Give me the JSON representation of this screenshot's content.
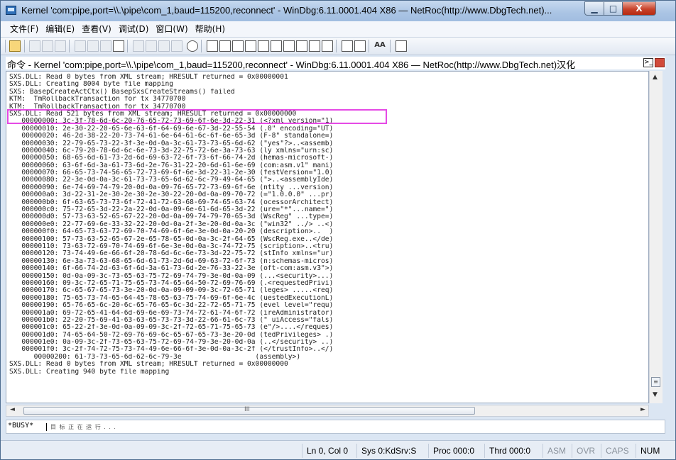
{
  "window": {
    "title": "Kernel 'com:pipe,port=\\\\.\\pipe\\com_1,baud=115200,reconnect' - WinDbg:6.11.0001.404 X86 — NetRoc(http://www.DbgTech.net)...",
    "min_glyph": "▁",
    "max_glyph": "□",
    "close_glyph": "X"
  },
  "menu": [
    "文件(F)",
    "编辑(E)",
    "查看(V)",
    "调试(D)",
    "窗口(W)",
    "帮助(H)"
  ],
  "toolbar": {
    "font_label": "AA"
  },
  "command_window": {
    "title": "命令 - Kernel 'com:pipe,port=\\\\.\\pipe\\com_1,baud=115200,reconnect' - WinDbg:6.11.0001.404 X86 — NetRoc(http://www.DbgTech.net)汉化"
  },
  "output": [
    "SXS.DLL: Read 0 bytes from XML stream; HRESULT returned = 0x00000001",
    "SXS.DLL: Creating 8004 byte file mapping",
    "SXS: BasepCreateActCtx() BasepSxsCreateStreams() failed",
    "KTM:  TmRollbackTransaction for tx 34770700",
    "KTM:  TmRollbackTransaction for tx 34770700",
    "SXS.DLL: Read 521 bytes from XML stream; HRESULT returned = 0x00000000",
    "   00000000: 3c-3f-78-6d-6c-20-76-65-72-73-69-6f-6e-3d-22-31 (<?xml version=\"1)",
    "   00000010: 2e-30-22-20-65-6e-63-6f-64-69-6e-67-3d-22-55-54 (.0\" encoding=\"UT)",
    "   00000020: 46-2d-38-22-20-73-74-61-6e-64-61-6c-6f-6e-65-3d (F-8\" standalone=)",
    "   00000030: 22-79-65-73-22-3f-3e-0d-0a-3c-61-73-73-65-6d-62 (\"yes\"?>..<assemb)",
    "   00000040: 6c-79-20-78-6d-6c-6e-73-3d-22-75-72-6e-3a-73-63 (ly xmlns=\"urn:sc)",
    "   00000050: 68-65-6d-61-73-2d-6d-69-63-72-6f-73-6f-66-74-2d (hemas-microsoft-)",
    "   00000060: 63-6f-6d-3a-61-73-6d-2e-76-31-22-20-6d-61-6e-69 (com:asm.v1\" mani)",
    "   00000070: 66-65-73-74-56-65-72-73-69-6f-6e-3d-22-31-2e-30 (festVersion=\"1.0)",
    "   00000080: 22-3e-0d-0a-3c-61-73-73-65-6d-62-6c-79-49-64-65 (\">..<assemblyIde)",
    "   00000090: 6e-74-69-74-79-20-0d-0a-09-76-65-72-73-69-6f-6e (ntity ...version)",
    "   000000a0: 3d-22-31-2e-30-2e-30-2e-30-22-20-0d-0a-09-70-72 (=\"1.0.0.0\" ...pr)",
    "   000000b0: 6f-63-65-73-73-6f-72-41-72-63-68-69-74-65-63-74 (ocessorArchitect)",
    "   000000c0: 75-72-65-3d-22-2a-22-0d-0a-09-6e-61-6d-65-3d-22 (ure=\"*\"...name=\")",
    "   000000d0: 57-73-63-52-65-67-22-20-0d-0a-09-74-79-70-65-3d (WscReg\" ...type=)",
    "   000000e0: 22-77-69-6e-33-32-22-20-0d-0a-2f-3e-20-0d-0a-3c (\"win32\" ../> ..<)",
    "   000000f0: 64-65-73-63-72-69-70-74-69-6f-6e-3e-0d-0a-20-20 (description>..  )",
    "   00000100: 57-73-63-52-65-67-2e-65-78-65-0d-0a-3c-2f-64-65 (WscReg.exe..</de)",
    "   00000110: 73-63-72-69-70-74-69-6f-6e-3e-0d-0a-3c-74-72-75 (scription>..<tru)",
    "   00000120: 73-74-49-6e-66-6f-20-78-6d-6c-6e-73-3d-22-75-72 (stInfo xmlns=\"ur)",
    "   00000130: 6e-3a-73-63-68-65-6d-61-73-2d-6d-69-63-72-6f-73 (n:schemas-micros)",
    "   00000140: 6f-66-74-2d-63-6f-6d-3a-61-73-6d-2e-76-33-22-3e (oft-com:asm.v3\">)",
    "   00000150: 0d-0a-09-3c-73-65-63-75-72-69-74-79-3e-0d-0a-09 (...<security>...)",
    "   00000160: 09-3c-72-65-71-75-65-73-74-65-64-50-72-69-76-69 (.<requestedPrivi)",
    "   00000170: 6c-65-67-65-73-3e-20-0d-0a-09-09-09-3c-72-65-71 (leges> .....<req)",
    "   00000180: 75-65-73-74-65-64-45-78-65-63-75-74-69-6f-6e-4c (uestedExecutionL)",
    "   00000190: 65-76-65-6c-20-6c-65-76-65-6c-3d-22-72-65-71-75 (evel level=\"requ)",
    "   000001a0: 69-72-65-41-64-6d-69-6e-69-73-74-72-61-74-6f-72 (ireAdministrator)",
    "   000001b0: 22-20-75-69-41-63-63-65-73-73-3d-22-66-61-6c-73 (\" uiAccess=\"fals)",
    "   000001c0: 65-22-2f-3e-0d-0a-09-09-3c-2f-72-65-71-75-65-73 (e\"/>....</reques)",
    "   000001d0: 74-65-64-50-72-69-76-69-6c-65-67-65-73-3e-20-0d (tedPrivileges> .)",
    "   000001e0: 0a-09-3c-2f-73-65-63-75-72-69-74-79-3e-20-0d-0a (..</security> ..)",
    "   000001f0: 3c-2f-74-72-75-73-74-49-6e-66-6f-3e-0d-0a-3c-2f (</trustInfo>..</)",
    "      00000200: 61-73-73-65-6d-62-6c-79-3e                  (assembly>)",
    "SXS.DLL: Read 0 bytes from XML stream; HRESULT returned = 0x00000000",
    "SXS.DLL: Creating 940 byte file mapping"
  ],
  "vscroll": {
    "up": "▲",
    "down": "▼",
    "grip": "≡"
  },
  "hscroll": {
    "left": "◄",
    "right": "►",
    "grip": "III"
  },
  "input": {
    "busy": "*BUSY*",
    "hint": "目 标 正 在 运 行 . . ."
  },
  "status": {
    "position": "Ln 0, Col 0",
    "sys": "Sys 0:KdSrv:S",
    "proc": "Proc 000:0",
    "thrd": "Thrd 000:0",
    "asm": "ASM",
    "ovr": "OVR",
    "caps": "CAPS",
    "num": "NUM"
  }
}
